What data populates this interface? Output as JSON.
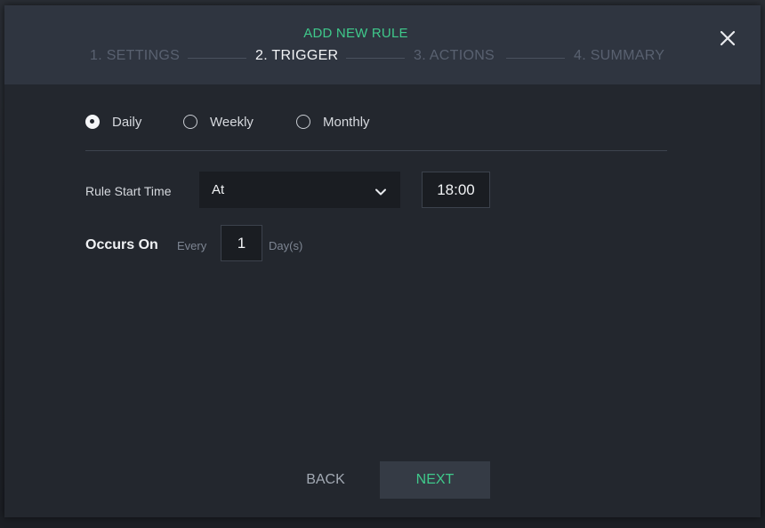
{
  "dialog": {
    "title": "ADD NEW RULE",
    "close_icon": "close-icon"
  },
  "steps": [
    {
      "label": "1. SETTINGS",
      "state": "inactive"
    },
    {
      "label": "2. TRIGGER",
      "state": "active"
    },
    {
      "label": "3. ACTIONS",
      "state": "inactive"
    },
    {
      "label": "4. SUMMARY",
      "state": "inactive"
    }
  ],
  "frequency": {
    "options": [
      {
        "label": "Daily",
        "checked": true
      },
      {
        "label": "Weekly",
        "checked": false
      },
      {
        "label": "Monthly",
        "checked": false
      }
    ],
    "selected": "Daily"
  },
  "start_time": {
    "label": "Rule Start Time",
    "mode": "At",
    "time": "18:00"
  },
  "occurs": {
    "label": "Occurs On",
    "every_label": "Every",
    "interval": "1",
    "unit_label": "Day(s)"
  },
  "footer": {
    "back_label": "BACK",
    "next_label": "NEXT"
  },
  "colors": {
    "accent": "#3fc98b",
    "header_bg": "#2f3540",
    "body_bg": "#23272e",
    "input_bg": "#1a1d22"
  }
}
